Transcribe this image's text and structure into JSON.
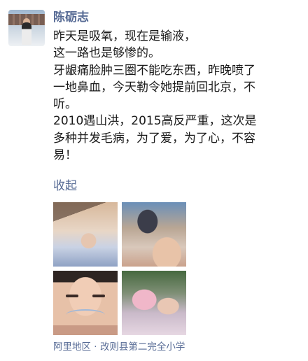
{
  "post": {
    "author": "陈砺志",
    "lines": [
      "昨天是吸氧，现在是输液，",
      "这一路也是够惨的。",
      "牙龈痛脸肿三圈不能吃东西，昨晚喷了",
      "一地鼻血，今天勒令她提前回北京，不",
      "听。",
      "2010遇山洪，2015高反严重，这次是",
      "多种并发毛病，为了爱，为了心，不容",
      "易！"
    ],
    "collapse_label": "收起",
    "location": "阿里地区 · 改则县第二完全小学"
  },
  "accent_color": "#576b95"
}
